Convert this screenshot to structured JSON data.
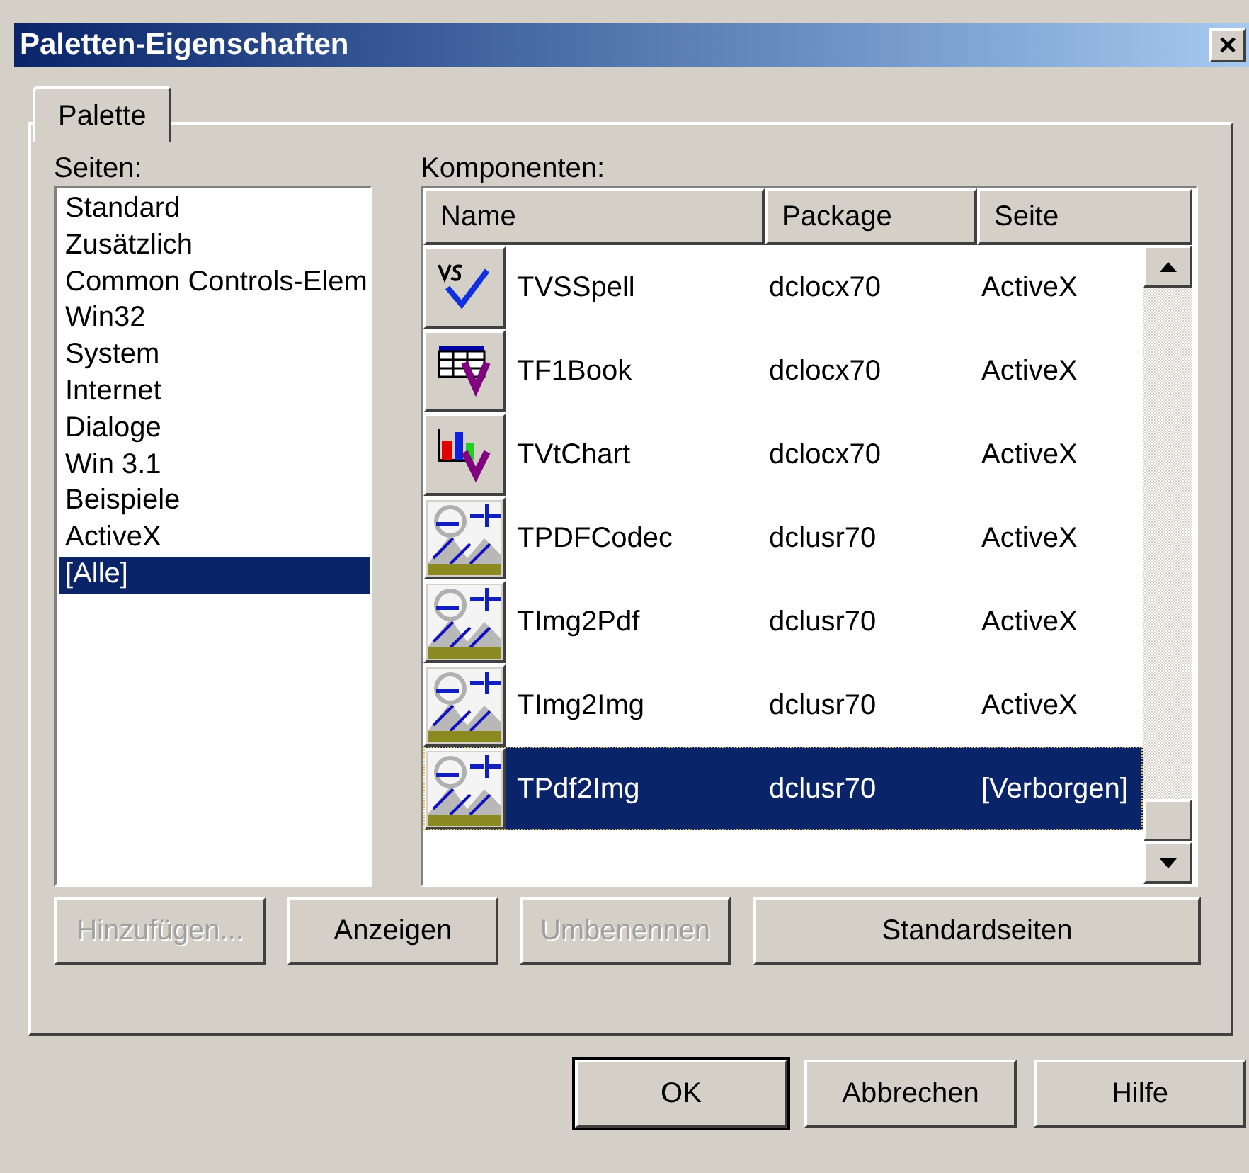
{
  "window": {
    "title": "Paletten-Eigenschaften",
    "close": "×"
  },
  "tabs": [
    {
      "label": "Palette",
      "selected": true
    }
  ],
  "pages": {
    "label": "Seiten:",
    "items": [
      {
        "label": "Standard",
        "selected": false
      },
      {
        "label": "Zusätzlich",
        "selected": false
      },
      {
        "label": "Common Controls-Elem",
        "selected": false
      },
      {
        "label": "Win32",
        "selected": false
      },
      {
        "label": "System",
        "selected": false
      },
      {
        "label": "Internet",
        "selected": false
      },
      {
        "label": "Dialoge",
        "selected": false
      },
      {
        "label": "Win 3.1",
        "selected": false
      },
      {
        "label": "Beispiele",
        "selected": false
      },
      {
        "label": "ActiveX",
        "selected": false
      },
      {
        "label": "[Alle]",
        "selected": true
      }
    ]
  },
  "components": {
    "label": "Komponenten:",
    "columns": [
      "Name",
      "Package",
      "Seite"
    ],
    "rows": [
      {
        "kind": "spell",
        "name": "TVSSpell",
        "package": "dclocx70",
        "page": "ActiveX",
        "selected": false
      },
      {
        "kind": "grid",
        "name": "TF1Book",
        "package": "dclocx70",
        "page": "ActiveX",
        "selected": false
      },
      {
        "kind": "chart",
        "name": "TVtChart",
        "package": "dclocx70",
        "page": "ActiveX",
        "selected": false
      },
      {
        "kind": "generic",
        "name": "TPDFCodec",
        "package": "dclusr70",
        "page": "ActiveX",
        "selected": false
      },
      {
        "kind": "generic",
        "name": "TImg2Pdf",
        "package": "dclusr70",
        "page": "ActiveX",
        "selected": false
      },
      {
        "kind": "generic",
        "name": "TImg2Img",
        "package": "dclusr70",
        "page": "ActiveX",
        "selected": false
      },
      {
        "kind": "generic",
        "name": "TPdf2Img",
        "package": "dclusr70",
        "page": "[Verborgen]",
        "selected": true
      }
    ]
  },
  "actions": [
    {
      "label": "Hinzufügen...",
      "disabled": true
    },
    {
      "label": "Anzeigen",
      "disabled": false
    },
    {
      "label": "Umbenennen",
      "disabled": true
    },
    {
      "label": "Standardseiten",
      "disabled": false
    }
  ],
  "buttons": [
    {
      "label": "OK",
      "default": true
    },
    {
      "label": "Abbrechen",
      "default": false
    },
    {
      "label": "Hilfe",
      "default": false
    }
  ]
}
